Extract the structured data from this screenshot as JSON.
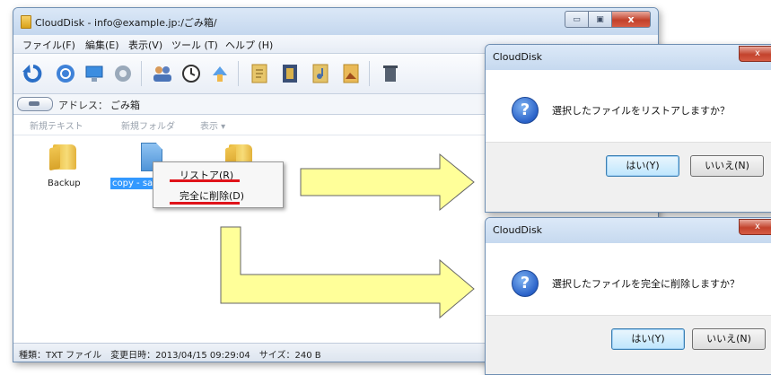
{
  "window": {
    "title": "CloudDisk - info@example.jp:/ごみ箱/",
    "min_glyph": "▭",
    "max_glyph": "▣",
    "close_glyph": "x"
  },
  "menu": [
    {
      "label": "ファイル(F)"
    },
    {
      "label": "編集(E)"
    },
    {
      "label": "表示(V)"
    },
    {
      "label": "ツール (T)"
    },
    {
      "label": "ヘルプ (H)"
    }
  ],
  "toolbar": {
    "icons": [
      "refresh-icon",
      "stop-icon",
      "computer-icon",
      "settings-icon",
      "users-icon",
      "clock-icon",
      "transfer-icon",
      "document-icon",
      "film-icon",
      "music-icon",
      "image-icon",
      "trash-icon"
    ]
  },
  "address": {
    "label": "アドレス：",
    "value": "ごみ箱"
  },
  "subtoolbar": {
    "new_text": "新規テキスト",
    "new_folder": "新規フォルダ",
    "view": "表示 ▾"
  },
  "files": [
    {
      "label": "Backup",
      "icon": "folder-icon"
    },
    {
      "label": "copy - sa",
      "icon": "document-icon",
      "selected": true
    },
    {
      "label": "",
      "icon": "folder-icon"
    }
  ],
  "context_menu": {
    "restore": "リストア(R)",
    "delete": "完全に削除(D)"
  },
  "status": {
    "text": "種類：TXT ファイル　変更日時：2013/04/15 09:29:04　サイズ：240 B"
  },
  "colors": {
    "highlight_red": "#e0131a",
    "arrow_fill": "#ffff99",
    "selection": "#3399ff"
  },
  "dialog_restore": {
    "title": "CloudDisk",
    "close_glyph": "x",
    "icon_glyph": "?",
    "message": "選択したファイルをリストアしますか？",
    "yes": "はい(Y)",
    "no": "いいえ(N)"
  },
  "dialog_delete": {
    "title": "CloudDisk",
    "close_glyph": "x",
    "icon_glyph": "?",
    "message": "選択したファイルを完全に削除しますか？",
    "yes": "はい(Y)",
    "no": "いいえ(N)"
  }
}
